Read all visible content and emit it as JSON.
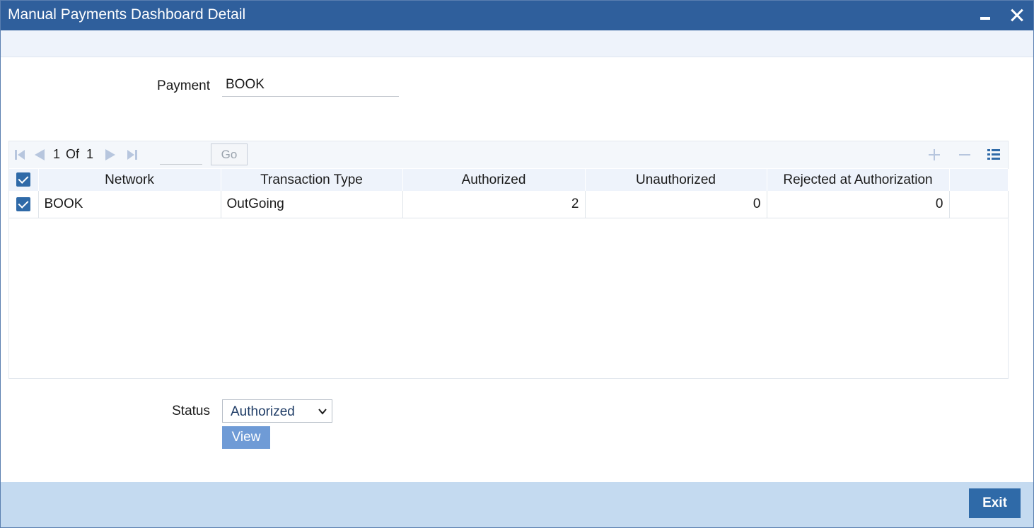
{
  "window": {
    "title": "Manual Payments Dashboard Detail",
    "minimize_icon": "minimize-icon",
    "close_icon": "close-icon"
  },
  "payment": {
    "label": "Payment",
    "value": "BOOK"
  },
  "pager": {
    "current": "1",
    "of_label": "Of",
    "total": "1",
    "go_label": "Go",
    "icons": [
      "first-page-icon",
      "previous-page-icon",
      "next-page-icon",
      "last-page-icon",
      "add-row-icon",
      "remove-row-icon",
      "columns-icon"
    ]
  },
  "grid": {
    "columns": [
      "Network",
      "Transaction Type",
      "Authorized",
      "Unauthorized",
      "Rejected at Authorization"
    ],
    "rows": [
      {
        "checked": true,
        "network": "BOOK",
        "transaction_type": "OutGoing",
        "authorized": "2",
        "unauthorized": "0",
        "rejected": "0"
      }
    ]
  },
  "status": {
    "label": "Status",
    "value": "Authorized",
    "view_label": "View"
  },
  "footer": {
    "exit_label": "Exit"
  },
  "colors": {
    "titlebar": "#2f5f9c",
    "accent": "#2f6aa8",
    "view_button": "#6f9bd6",
    "footer": "#c4daf0"
  }
}
